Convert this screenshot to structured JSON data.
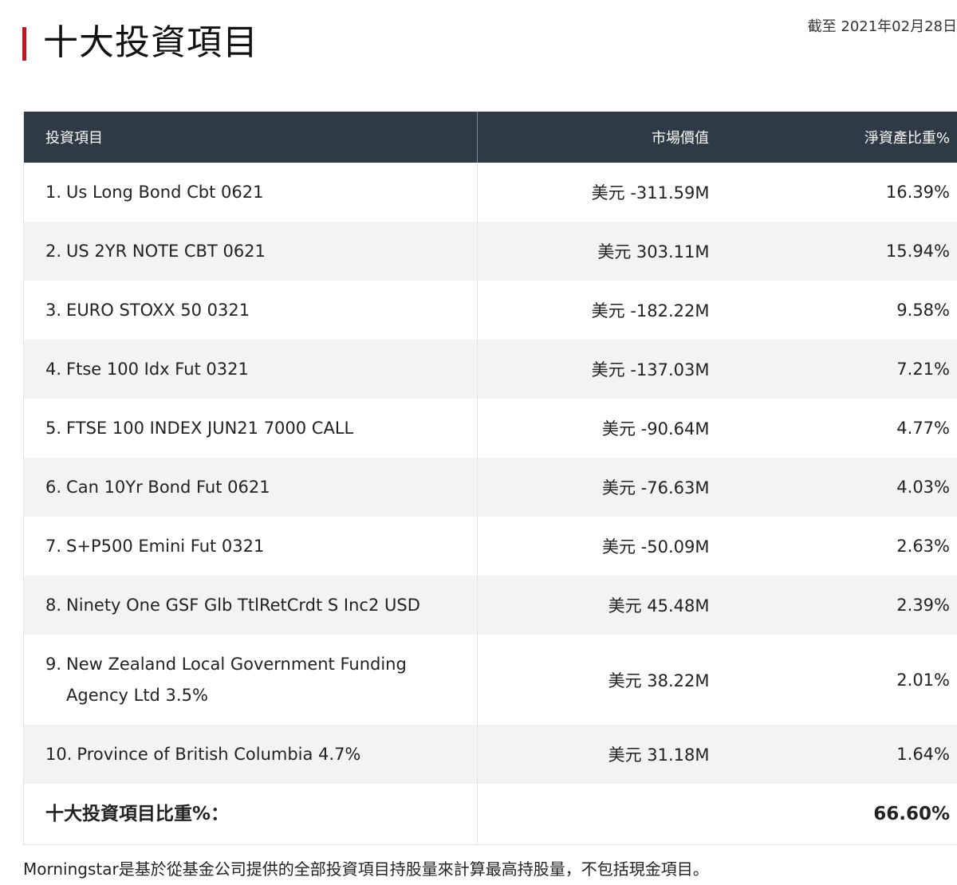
{
  "header": {
    "title": "十大投資項目",
    "as_of": "截至 2021年02月28日",
    "accent_color": "#c4161c"
  },
  "table": {
    "header_bg": "#2e3a45",
    "columns": [
      "投資項目",
      "市場價值",
      "淨資產比重%"
    ],
    "rows": [
      {
        "num": "1.",
        "name": "Us Long Bond Cbt 0621",
        "market_value": "美元 -311.59M",
        "weight": "16.39%"
      },
      {
        "num": "2.",
        "name": "US 2YR NOTE CBT 0621",
        "market_value": "美元 303.11M",
        "weight": "15.94%"
      },
      {
        "num": "3.",
        "name": "EURO STOXX 50 0321",
        "market_value": "美元 -182.22M",
        "weight": "9.58%"
      },
      {
        "num": "4.",
        "name": "Ftse 100 Idx Fut 0321",
        "market_value": "美元 -137.03M",
        "weight": "7.21%"
      },
      {
        "num": "5.",
        "name": "FTSE 100 INDEX JUN21 7000 CALL",
        "market_value": "美元 -90.64M",
        "weight": "4.77%"
      },
      {
        "num": "6.",
        "name": "Can 10Yr Bond Fut 0621",
        "market_value": "美元 -76.63M",
        "weight": "4.03%"
      },
      {
        "num": "7.",
        "name": "S+P500 Emini Fut 0321",
        "market_value": "美元 -50.09M",
        "weight": "2.63%"
      },
      {
        "num": "8.",
        "name": "Ninety One GSF Glb TtlRetCrdt S Inc2 USD",
        "market_value": "美元 45.48M",
        "weight": "2.39%"
      },
      {
        "num": "9.",
        "name": "New Zealand Local Government Funding Agency Ltd 3.5%",
        "market_value": "美元 38.22M",
        "weight": "2.01%"
      },
      {
        "num": "10.",
        "name": "Province of British Columbia 4.7%",
        "market_value": "美元 31.18M",
        "weight": "1.64%"
      }
    ],
    "total": {
      "label": "十大投資項目比重%：",
      "value": "66.60%"
    }
  },
  "footnote": "Morningstar是基於從基金公司提供的全部投資項目持股量來計算最高持股量，不包括現金項目。"
}
